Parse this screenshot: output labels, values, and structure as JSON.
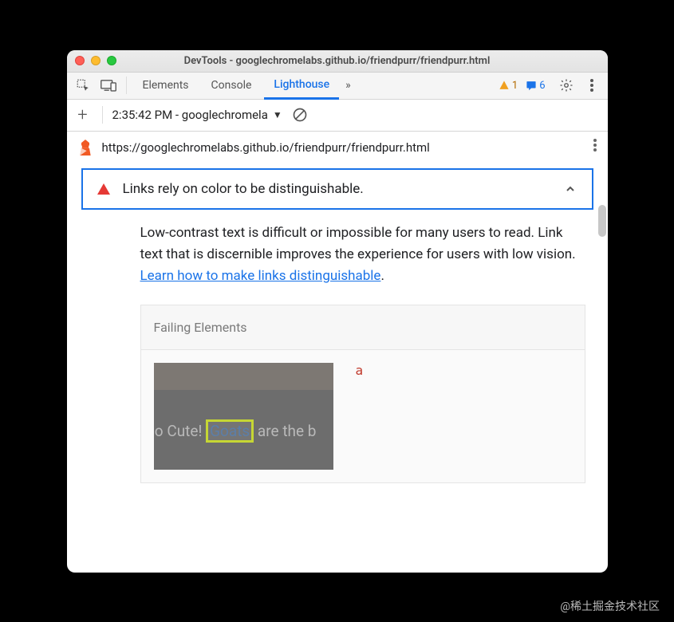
{
  "window": {
    "title": "DevTools - googlechromelabs.github.io/friendpurr/friendpurr.html"
  },
  "tabs": {
    "elements": "Elements",
    "console": "Console",
    "lighthouse": "Lighthouse",
    "warn_count": "1",
    "msg_count": "6"
  },
  "context": {
    "run_label": "2:35:42 PM - googlechromela"
  },
  "url": "https://googlechromelabs.github.io/friendpurr/friendpurr.html",
  "audit": {
    "title": "Links rely on color to be distinguishable.",
    "desc_pre": "Low-contrast text is difficult or impossible for many users to read. Link text that is discernible improves the experience for users with low vision. ",
    "learn_link": "Learn how to make links distinguishable",
    "desc_post": "."
  },
  "failing": {
    "header": "Failing Elements",
    "element_tag": "a",
    "thumb": {
      "pre": "So Cute! ",
      "highlight": "Goats",
      "post": " are the b"
    }
  },
  "watermark": "@稀土掘金技术社区"
}
